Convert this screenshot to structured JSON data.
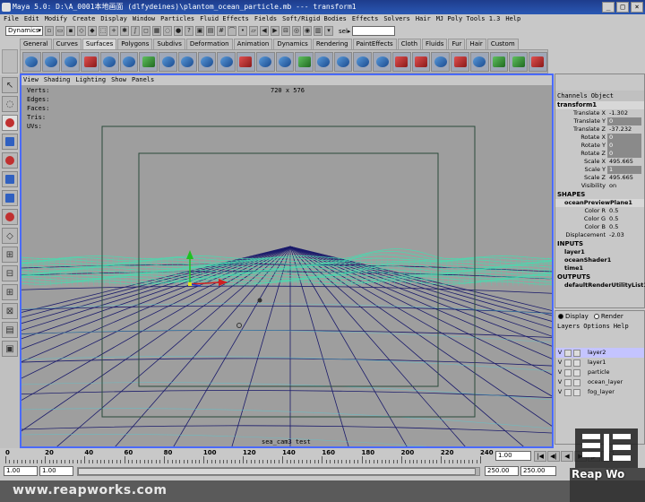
{
  "window": {
    "title": "Maya 5.0: D:\\A_0001本地画面 (dlfydeines)\\plantom_ocean_particle.mb  ---  transform1",
    "buttons": [
      "_",
      "□",
      "×"
    ]
  },
  "menubar": [
    "File",
    "Edit",
    "Modify",
    "Create",
    "Display",
    "Window",
    "Particles",
    "Fluid Effects",
    "Fields",
    "Soft/Rigid Bodies",
    "Effects",
    "Solvers",
    "Hair",
    "MJ Poly Tools 1.3",
    "Help"
  ],
  "statusline": {
    "menuset": "Dynamics",
    "sel_label": "sel▸",
    "sel_value": ""
  },
  "shelf": {
    "tabs": [
      "General",
      "Curves",
      "Surfaces",
      "Polygons",
      "Subdivs",
      "Deformation",
      "Animation",
      "Dynamics",
      "Rendering",
      "PaintEffects",
      "Cloth",
      "Fluids",
      "Fur",
      "Hair",
      "Custom"
    ],
    "active_tab": "Surfaces",
    "icon_count": 27
  },
  "viewport": {
    "menu": [
      "View",
      "Shading",
      "Lighting",
      "Show",
      "Panels"
    ],
    "hud_labels": [
      "Verts:",
      "Edges:",
      "Faces:",
      "Tris:",
      "UVs:"
    ],
    "resolution": "720 x 576",
    "camera": "sea_cam3 test",
    "background": "#9e9e9e",
    "grid_color": "#1a1a6a",
    "wave_color": "#40e0b0"
  },
  "channelbox": {
    "menu": [
      "Channels",
      "Object"
    ],
    "object": "transform1",
    "attributes": [
      {
        "name": "Translate X",
        "value": "-1.302",
        "hl": false
      },
      {
        "name": "Translate Y",
        "value": "0",
        "hl": true
      },
      {
        "name": "Translate Z",
        "value": "-37.232",
        "hl": false
      },
      {
        "name": "Rotate X",
        "value": "0",
        "hl": true
      },
      {
        "name": "Rotate Y",
        "value": "0",
        "hl": true
      },
      {
        "name": "Rotate Z",
        "value": "0",
        "hl": true
      },
      {
        "name": "Scale X",
        "value": "495.665",
        "hl": false
      },
      {
        "name": "Scale Y",
        "value": "1",
        "hl": true
      },
      {
        "name": "Scale Z",
        "value": "495.665",
        "hl": false
      },
      {
        "name": "Visibility",
        "value": "on",
        "hl": false
      }
    ],
    "shapes_label": "SHAPES",
    "shape_name": "oceanPreviewPlane1",
    "shape_attrs": [
      {
        "name": "Color R",
        "value": "0.5"
      },
      {
        "name": "Color G",
        "value": "0.5"
      },
      {
        "name": "Color B",
        "value": "0.5"
      },
      {
        "name": "Displacement",
        "value": "-2.03"
      }
    ],
    "inputs_label": "INPUTS",
    "inputs": [
      "layer1",
      "oceanShader1",
      "time1"
    ],
    "outputs_label": "OUTPUTS",
    "outputs": [
      "defaultRenderUtilityList1"
    ]
  },
  "layers": {
    "display_label": "Display",
    "render_label": "Render",
    "menu": [
      "Layers",
      "Options",
      "Help"
    ],
    "rows": [
      {
        "v": "V",
        "name": "layer2",
        "selected": true
      },
      {
        "v": "V",
        "name": "layer1",
        "selected": false
      },
      {
        "v": "V",
        "name": "particle",
        "selected": false
      },
      {
        "v": "V",
        "name": "ocean_layer",
        "selected": false
      },
      {
        "v": "V",
        "name": "fog_layer",
        "selected": false
      }
    ]
  },
  "timeline": {
    "ticks": [
      "0",
      "20",
      "40",
      "60",
      "80",
      "100",
      "120",
      "140",
      "160",
      "180",
      "200",
      "220",
      "240"
    ],
    "current_frame": "1.00",
    "play_buttons": [
      "|◀",
      "◀|",
      "◀",
      "▶",
      "|▶",
      "▶|"
    ]
  },
  "range": {
    "start": "1.00",
    "anim_start": "1.00",
    "range_end": "250.00",
    "anim_end": "250.00"
  },
  "watermark": {
    "url": "www.reapworks.com",
    "logo_text": "Reap Wo"
  }
}
